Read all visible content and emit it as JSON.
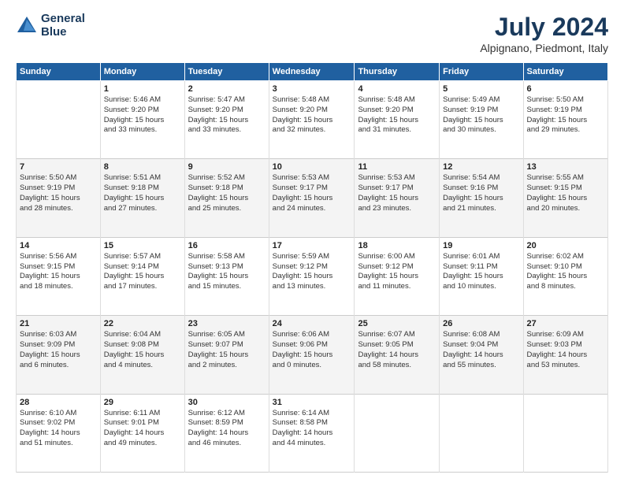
{
  "header": {
    "logo_line1": "General",
    "logo_line2": "Blue",
    "main_title": "July 2024",
    "subtitle": "Alpignano, Piedmont, Italy"
  },
  "days_of_week": [
    "Sunday",
    "Monday",
    "Tuesday",
    "Wednesday",
    "Thursday",
    "Friday",
    "Saturday"
  ],
  "weeks": [
    [
      {
        "day": "",
        "info": ""
      },
      {
        "day": "1",
        "info": "Sunrise: 5:46 AM\nSunset: 9:20 PM\nDaylight: 15 hours\nand 33 minutes."
      },
      {
        "day": "2",
        "info": "Sunrise: 5:47 AM\nSunset: 9:20 PM\nDaylight: 15 hours\nand 33 minutes."
      },
      {
        "day": "3",
        "info": "Sunrise: 5:48 AM\nSunset: 9:20 PM\nDaylight: 15 hours\nand 32 minutes."
      },
      {
        "day": "4",
        "info": "Sunrise: 5:48 AM\nSunset: 9:20 PM\nDaylight: 15 hours\nand 31 minutes."
      },
      {
        "day": "5",
        "info": "Sunrise: 5:49 AM\nSunset: 9:19 PM\nDaylight: 15 hours\nand 30 minutes."
      },
      {
        "day": "6",
        "info": "Sunrise: 5:50 AM\nSunset: 9:19 PM\nDaylight: 15 hours\nand 29 minutes."
      }
    ],
    [
      {
        "day": "7",
        "info": "Sunrise: 5:50 AM\nSunset: 9:19 PM\nDaylight: 15 hours\nand 28 minutes."
      },
      {
        "day": "8",
        "info": "Sunrise: 5:51 AM\nSunset: 9:18 PM\nDaylight: 15 hours\nand 27 minutes."
      },
      {
        "day": "9",
        "info": "Sunrise: 5:52 AM\nSunset: 9:18 PM\nDaylight: 15 hours\nand 25 minutes."
      },
      {
        "day": "10",
        "info": "Sunrise: 5:53 AM\nSunset: 9:17 PM\nDaylight: 15 hours\nand 24 minutes."
      },
      {
        "day": "11",
        "info": "Sunrise: 5:53 AM\nSunset: 9:17 PM\nDaylight: 15 hours\nand 23 minutes."
      },
      {
        "day": "12",
        "info": "Sunrise: 5:54 AM\nSunset: 9:16 PM\nDaylight: 15 hours\nand 21 minutes."
      },
      {
        "day": "13",
        "info": "Sunrise: 5:55 AM\nSunset: 9:15 PM\nDaylight: 15 hours\nand 20 minutes."
      }
    ],
    [
      {
        "day": "14",
        "info": "Sunrise: 5:56 AM\nSunset: 9:15 PM\nDaylight: 15 hours\nand 18 minutes."
      },
      {
        "day": "15",
        "info": "Sunrise: 5:57 AM\nSunset: 9:14 PM\nDaylight: 15 hours\nand 17 minutes."
      },
      {
        "day": "16",
        "info": "Sunrise: 5:58 AM\nSunset: 9:13 PM\nDaylight: 15 hours\nand 15 minutes."
      },
      {
        "day": "17",
        "info": "Sunrise: 5:59 AM\nSunset: 9:12 PM\nDaylight: 15 hours\nand 13 minutes."
      },
      {
        "day": "18",
        "info": "Sunrise: 6:00 AM\nSunset: 9:12 PM\nDaylight: 15 hours\nand 11 minutes."
      },
      {
        "day": "19",
        "info": "Sunrise: 6:01 AM\nSunset: 9:11 PM\nDaylight: 15 hours\nand 10 minutes."
      },
      {
        "day": "20",
        "info": "Sunrise: 6:02 AM\nSunset: 9:10 PM\nDaylight: 15 hours\nand 8 minutes."
      }
    ],
    [
      {
        "day": "21",
        "info": "Sunrise: 6:03 AM\nSunset: 9:09 PM\nDaylight: 15 hours\nand 6 minutes."
      },
      {
        "day": "22",
        "info": "Sunrise: 6:04 AM\nSunset: 9:08 PM\nDaylight: 15 hours\nand 4 minutes."
      },
      {
        "day": "23",
        "info": "Sunrise: 6:05 AM\nSunset: 9:07 PM\nDaylight: 15 hours\nand 2 minutes."
      },
      {
        "day": "24",
        "info": "Sunrise: 6:06 AM\nSunset: 9:06 PM\nDaylight: 15 hours\nand 0 minutes."
      },
      {
        "day": "25",
        "info": "Sunrise: 6:07 AM\nSunset: 9:05 PM\nDaylight: 14 hours\nand 58 minutes."
      },
      {
        "day": "26",
        "info": "Sunrise: 6:08 AM\nSunset: 9:04 PM\nDaylight: 14 hours\nand 55 minutes."
      },
      {
        "day": "27",
        "info": "Sunrise: 6:09 AM\nSunset: 9:03 PM\nDaylight: 14 hours\nand 53 minutes."
      }
    ],
    [
      {
        "day": "28",
        "info": "Sunrise: 6:10 AM\nSunset: 9:02 PM\nDaylight: 14 hours\nand 51 minutes."
      },
      {
        "day": "29",
        "info": "Sunrise: 6:11 AM\nSunset: 9:01 PM\nDaylight: 14 hours\nand 49 minutes."
      },
      {
        "day": "30",
        "info": "Sunrise: 6:12 AM\nSunset: 8:59 PM\nDaylight: 14 hours\nand 46 minutes."
      },
      {
        "day": "31",
        "info": "Sunrise: 6:14 AM\nSunset: 8:58 PM\nDaylight: 14 hours\nand 44 minutes."
      },
      {
        "day": "",
        "info": ""
      },
      {
        "day": "",
        "info": ""
      },
      {
        "day": "",
        "info": ""
      }
    ]
  ]
}
